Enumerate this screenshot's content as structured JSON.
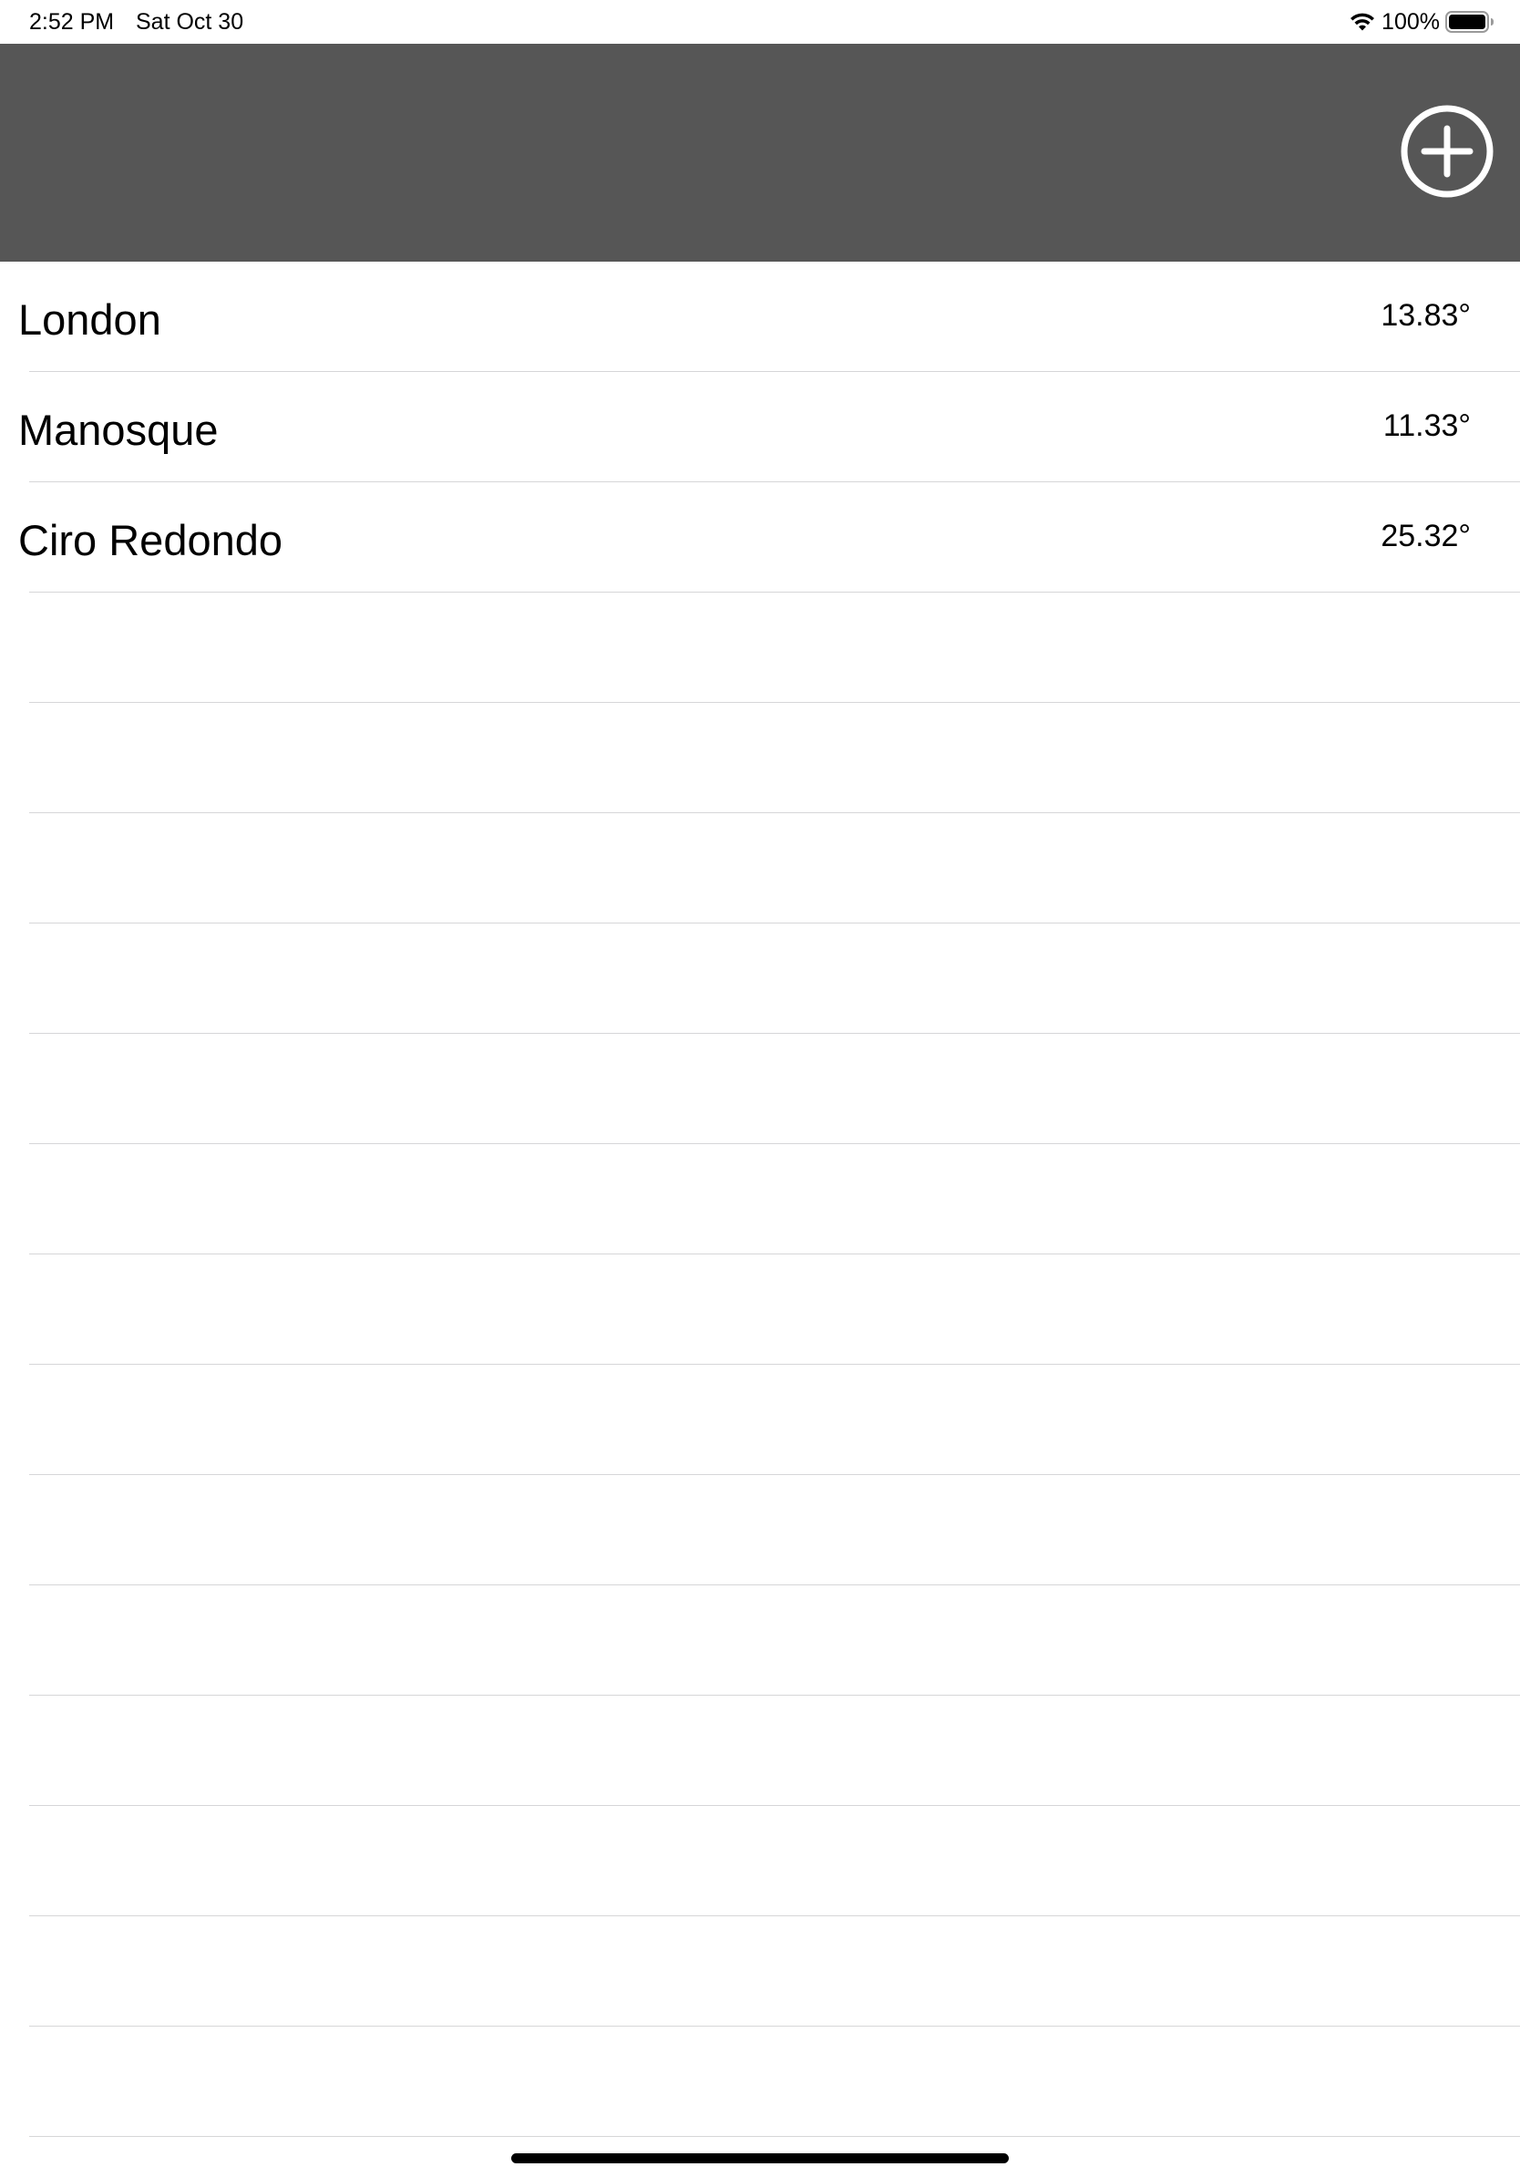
{
  "status_bar": {
    "time": "2:52 PM",
    "date": "Sat Oct 30",
    "battery_percent": "100%",
    "icons": [
      "wifi-icon",
      "battery-icon"
    ]
  },
  "header": {
    "background_color": "#565656",
    "add_button_icon": "plus-circle-icon"
  },
  "cities": [
    {
      "name": "London",
      "temperature": "13.83°"
    },
    {
      "name": "Manosque",
      "temperature": "11.33°"
    },
    {
      "name": "Ciro Redondo",
      "temperature": "25.32°"
    }
  ]
}
